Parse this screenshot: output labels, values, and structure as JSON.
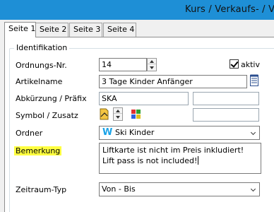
{
  "window": {
    "title": "Kurs / Verkaufs- / V"
  },
  "tabs": [
    {
      "label": "Seite 1",
      "active": true
    },
    {
      "label": "Seite 2",
      "active": false
    },
    {
      "label": "Seite 3",
      "active": false
    },
    {
      "label": "Seite 4",
      "active": false
    }
  ],
  "group": {
    "label": "Identifikation"
  },
  "form": {
    "ordnungs_nr": {
      "label": "Ordnungs-Nr.",
      "value": "14"
    },
    "aktiv": {
      "label": "aktiv",
      "checked": true
    },
    "artikelname": {
      "label": "Artikelname",
      "value": "3 Tage Kinder Anfänger"
    },
    "abkuerzung": {
      "label": "Abkürzung / Präfix",
      "value": "SKA",
      "second_value": ""
    },
    "symbol": {
      "label": "Symbol / Zusatz",
      "value": ""
    },
    "ordner": {
      "label": "Ordner",
      "value": "Ski Kinder",
      "icon_letter": "W"
    },
    "bemerkung": {
      "label": "Bemerkung",
      "lines": [
        "Liftkarte ist nicht im Preis inkludiert!",
        "Lift pass is not included!"
      ]
    },
    "zeitraum": {
      "label": "Zeitraum-Typ",
      "value": "Von - Bis"
    }
  },
  "colors": {
    "titlebar": "#1e8fd6",
    "highlight": "#ffff40",
    "ordner_icon": "#1aa3e8"
  }
}
